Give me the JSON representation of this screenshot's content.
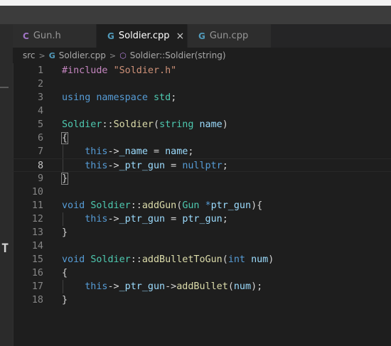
{
  "colors": {
    "c_icon": "#519aba",
    "header_icon": "#a074c4",
    "symbol_icon": "#b180d7"
  },
  "tool_icon_glyph": "T",
  "tabs": [
    {
      "label": "Gun.h",
      "icon": "C",
      "icon_name": "c-header-file-icon",
      "active": false
    },
    {
      "label": "Soldier.cpp",
      "icon": "G",
      "icon_name": "cpp-file-icon",
      "active": true,
      "close": "×"
    },
    {
      "label": "Gun.cpp",
      "icon": "G",
      "icon_name": "cpp-file-icon",
      "active": false
    }
  ],
  "breadcrumb": {
    "folder": "src",
    "file": "Soldier.cpp",
    "symbol": "Soldier::Soldier(string)",
    "separator": ">",
    "file_icon": "G",
    "symbol_icon": "⬡"
  },
  "editor": {
    "current_line": 8,
    "lines": [
      {
        "n": "1",
        "tokens": [
          {
            "t": "#include ",
            "c": "k-pre"
          },
          {
            "t": "\"Soldier.h\"",
            "c": "k-str"
          }
        ]
      },
      {
        "n": "2",
        "tokens": []
      },
      {
        "n": "3",
        "tokens": [
          {
            "t": "using ",
            "c": "k-kw"
          },
          {
            "t": "namespace ",
            "c": "k-kw"
          },
          {
            "t": "std",
            "c": "k-type"
          },
          {
            "t": ";",
            "c": "k-txt"
          }
        ]
      },
      {
        "n": "4",
        "tokens": []
      },
      {
        "n": "5",
        "tokens": [
          {
            "t": "Soldier",
            "c": "k-type"
          },
          {
            "t": "::",
            "c": "k-txt"
          },
          {
            "t": "Soldier",
            "c": "k-fn"
          },
          {
            "t": "(",
            "c": "k-txt"
          },
          {
            "t": "string ",
            "c": "k-type"
          },
          {
            "t": "name",
            "c": "k-var"
          },
          {
            "t": ")",
            "c": "k-txt"
          }
        ]
      },
      {
        "n": "6",
        "tokens": [
          {
            "t": "{",
            "c": "k-txt",
            "hl": true
          }
        ]
      },
      {
        "n": "7",
        "guide": true,
        "tokens": [
          {
            "t": "    this",
            "c": "k-kw"
          },
          {
            "t": "->",
            "c": "k-txt"
          },
          {
            "t": "_name",
            "c": "k-var"
          },
          {
            "t": " = ",
            "c": "k-txt"
          },
          {
            "t": "name",
            "c": "k-var"
          },
          {
            "t": ";",
            "c": "k-txt"
          }
        ]
      },
      {
        "n": "8",
        "guide": true,
        "tokens": [
          {
            "t": "    this",
            "c": "k-kw"
          },
          {
            "t": "->",
            "c": "k-txt"
          },
          {
            "t": "_ptr_gun",
            "c": "k-var"
          },
          {
            "t": " = ",
            "c": "k-txt"
          },
          {
            "t": "nullptr",
            "c": "k-kw"
          },
          {
            "t": ";",
            "c": "k-txt"
          }
        ]
      },
      {
        "n": "9",
        "tokens": [
          {
            "t": "}",
            "c": "k-txt",
            "hl": true
          }
        ]
      },
      {
        "n": "10",
        "tokens": []
      },
      {
        "n": "11",
        "tokens": [
          {
            "t": "void ",
            "c": "k-kw"
          },
          {
            "t": "Soldier",
            "c": "k-type"
          },
          {
            "t": "::",
            "c": "k-txt"
          },
          {
            "t": "addGun",
            "c": "k-fn"
          },
          {
            "t": "(",
            "c": "k-txt"
          },
          {
            "t": "Gun ",
            "c": "k-type"
          },
          {
            "t": "*",
            "c": "k-kw"
          },
          {
            "t": "ptr_gun",
            "c": "k-var"
          },
          {
            "t": "){",
            "c": "k-txt"
          }
        ]
      },
      {
        "n": "12",
        "guide": true,
        "tokens": [
          {
            "t": "    this",
            "c": "k-kw"
          },
          {
            "t": "->",
            "c": "k-txt"
          },
          {
            "t": "_ptr_gun",
            "c": "k-var"
          },
          {
            "t": " = ",
            "c": "k-txt"
          },
          {
            "t": "ptr_gun",
            "c": "k-var"
          },
          {
            "t": ";",
            "c": "k-txt"
          }
        ]
      },
      {
        "n": "13",
        "tokens": [
          {
            "t": "}",
            "c": "k-txt"
          }
        ]
      },
      {
        "n": "14",
        "tokens": []
      },
      {
        "n": "15",
        "tokens": [
          {
            "t": "void ",
            "c": "k-kw"
          },
          {
            "t": "Soldier",
            "c": "k-type"
          },
          {
            "t": "::",
            "c": "k-txt"
          },
          {
            "t": "addBulletToGun",
            "c": "k-fn"
          },
          {
            "t": "(",
            "c": "k-txt"
          },
          {
            "t": "int ",
            "c": "k-kw"
          },
          {
            "t": "num",
            "c": "k-var"
          },
          {
            "t": ")",
            "c": "k-txt"
          }
        ]
      },
      {
        "n": "16",
        "tokens": [
          {
            "t": "{",
            "c": "k-txt"
          }
        ]
      },
      {
        "n": "17",
        "guide": true,
        "tokens": [
          {
            "t": "    this",
            "c": "k-kw"
          },
          {
            "t": "->",
            "c": "k-txt"
          },
          {
            "t": "_ptr_gun",
            "c": "k-var"
          },
          {
            "t": "->",
            "c": "k-txt"
          },
          {
            "t": "addBullet",
            "c": "k-fn"
          },
          {
            "t": "(",
            "c": "k-txt"
          },
          {
            "t": "num",
            "c": "k-var"
          },
          {
            "t": ");",
            "c": "k-txt"
          }
        ]
      },
      {
        "n": "18",
        "tokens": [
          {
            "t": "}",
            "c": "k-txt"
          }
        ]
      }
    ]
  }
}
